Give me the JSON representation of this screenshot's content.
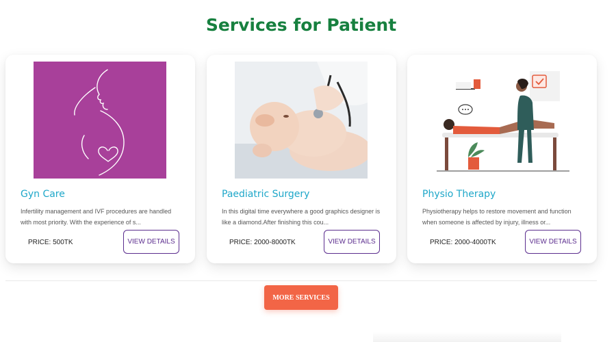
{
  "page": {
    "title": "Services for Patient"
  },
  "services": [
    {
      "title": "Gyn Care",
      "description": "Infertility management and IVF procedures are handled with most priority. With the experience of s...",
      "price": "PRICE: 500TK",
      "button": "VIEW DETAILS"
    },
    {
      "title": "Paediatric Surgery",
      "description": "In this digital time everywhere a good graphics designer is like a diamond.After finishing this cou...",
      "price": "PRICE: 2000-8000TK",
      "button": "VIEW DETAILS"
    },
    {
      "title": "Physio Therapy",
      "description": "Physiotherapy helps to restore movement and function when someone is affected by injury, illness or...",
      "price": "PRICE: 2000-4000TK",
      "button": "VIEW DETAILS"
    }
  ],
  "more_services_label": "MORE SERVICES",
  "colors": {
    "title": "#17803f",
    "card_title": "#1ea7c9",
    "button_border": "#5b2d8e",
    "more_button": "#f26546",
    "gyn_bg": "#a8409a"
  },
  "icons": {
    "gyn": "pregnancy-heart-illustration",
    "paediatric": "baby-stethoscope-photo",
    "physio": "physiotherapy-illustration"
  }
}
